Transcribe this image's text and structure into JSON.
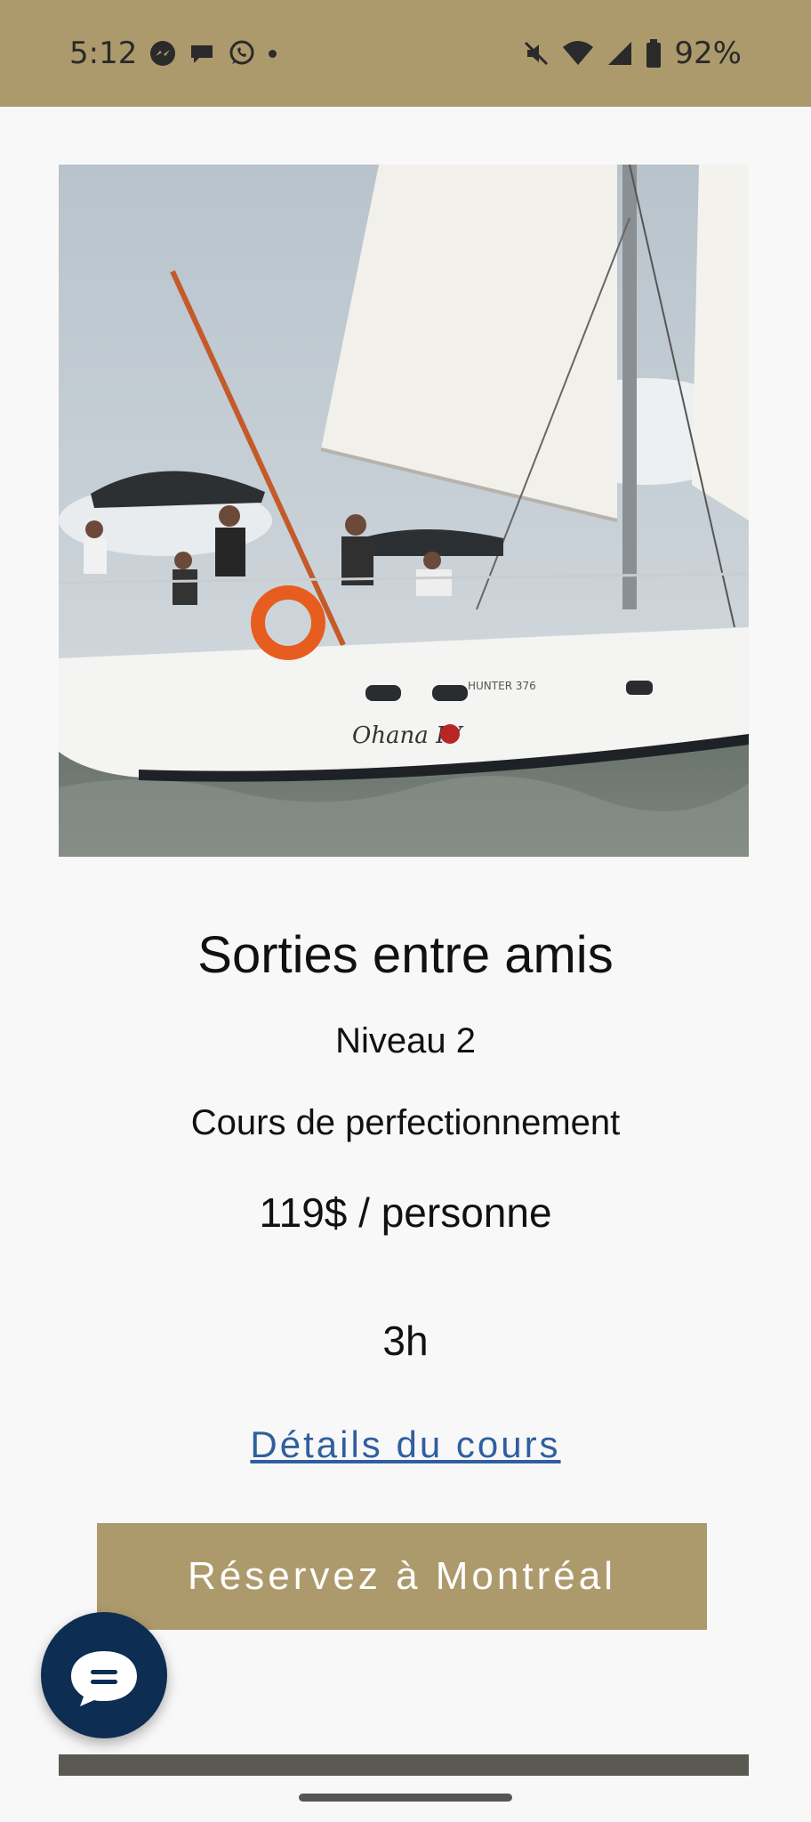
{
  "status_bar": {
    "time": "5:12",
    "battery_pct": "92%",
    "left_icons": [
      "messenger-icon",
      "chat-bubble-icon",
      "whatsapp-icon",
      "dot-icon"
    ],
    "right_icons": [
      "mute-icon",
      "wifi-icon",
      "signal-icon",
      "battery-icon"
    ]
  },
  "course": {
    "title": "Sorties entre amis",
    "level": "Niveau 2",
    "description": "Cours de perfectionnement",
    "price": "119$ / personne",
    "duration": "3h",
    "details_link": "Détails du cours",
    "book_button": "Réservez à Montréal"
  },
  "colors": {
    "accent": "#ad9a6c",
    "link": "#2f5f9e",
    "fab": "#0e2d52"
  }
}
